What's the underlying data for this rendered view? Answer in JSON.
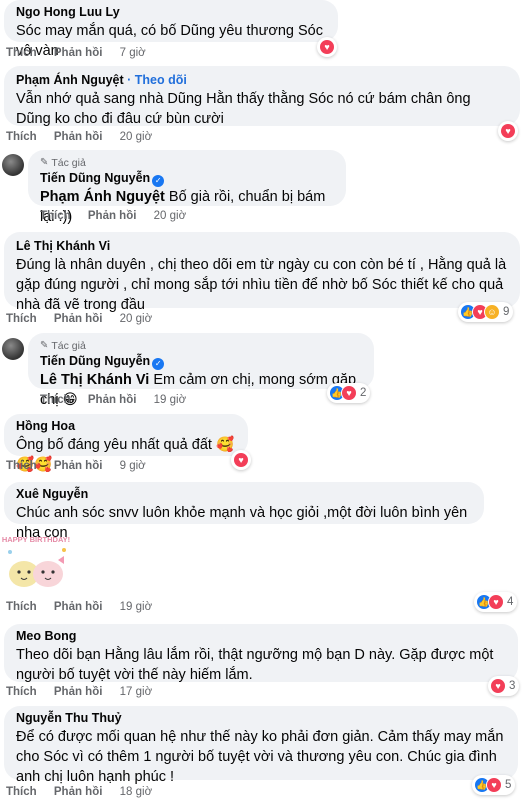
{
  "actions": {
    "like": "Thích",
    "reply": "Phản hồi"
  },
  "author_tag": "Tác giả",
  "comments": [
    {
      "author": "Ngo Hong Luu Ly",
      "text": "Sóc may mắn quá, có bố Dũng yêu thương Sóc vô vàn",
      "time": "7 giờ"
    },
    {
      "author": "Phạm Ánh Nguyệt",
      "follow": "Theo dõi",
      "text": "Vẫn nhớ quả sang nhà Dũng Hằn thấy thằng Sóc nó cứ bám chân ông Dũng ko cho đi đâu cứ bùn cười",
      "time": "20 giờ"
    },
    {
      "author": "Tiến Dũng Nguyễn",
      "mention": "Phạm Ánh Nguyệt",
      "text": " Bố già rồi, chuẩn bị bám lại :))",
      "time": "20 giờ"
    },
    {
      "author": "Lê Thị Khánh Vi",
      "text": "Đúng là nhân duyên , chị theo dõi em từ ngày cu con còn bé tí , Hằng quả là gặp đúng người , chỉ mong sắp tới nhìu tiền để nhờ bố Sóc thiết kế cho quả nhà đã vẽ trong đầu",
      "time": "20 giờ",
      "react_count": "9"
    },
    {
      "author": "Tiến Dũng Nguyễn",
      "mention": "Lê Thị Khánh Vi",
      "text": " Em cảm ơn chị, mong sớm gặp chị 😁",
      "time": "19 giờ",
      "react_count": "2"
    },
    {
      "author": "Hồng Hoa",
      "text": "Ông bố đáng yêu nhất quả đất 🥰🥰🥰",
      "time": "9 giờ"
    },
    {
      "author": "Xuê Nguyễn",
      "text": "Chúc anh sóc snvv luôn khỏe mạnh và học giỏi ,một đời luôn bình yên nha con",
      "time": "19 giờ",
      "react_count": "4",
      "sticker_text": "HAPPY BIRTHDAY!"
    },
    {
      "author": "Meo Bong",
      "text": "Theo dõi bạn Hằng lâu lắm rồi, thật ngưỡng mộ bạn D này. Gặp được một người bố tuyệt vời thế này hiếm lắm.",
      "time": "17 giờ",
      "react_count": "3"
    },
    {
      "author": "Nguyễn Thu Thuỷ",
      "text": "Để có được mối quan hệ như thế này ko phải đơn giản. Cảm thấy may mắn cho Sóc vì có thêm 1 người bố tuyệt vời và thương yêu con. Chúc gia đình anh chị luôn hạnh phúc !",
      "time": "18 giờ",
      "react_count": "5"
    }
  ],
  "colors": {
    "bubble": "#f0f2f5",
    "follow": "#216fdb",
    "like": "#1877f2",
    "love": "#f33e58",
    "care": "#f7b125",
    "meta": "#65676b"
  }
}
